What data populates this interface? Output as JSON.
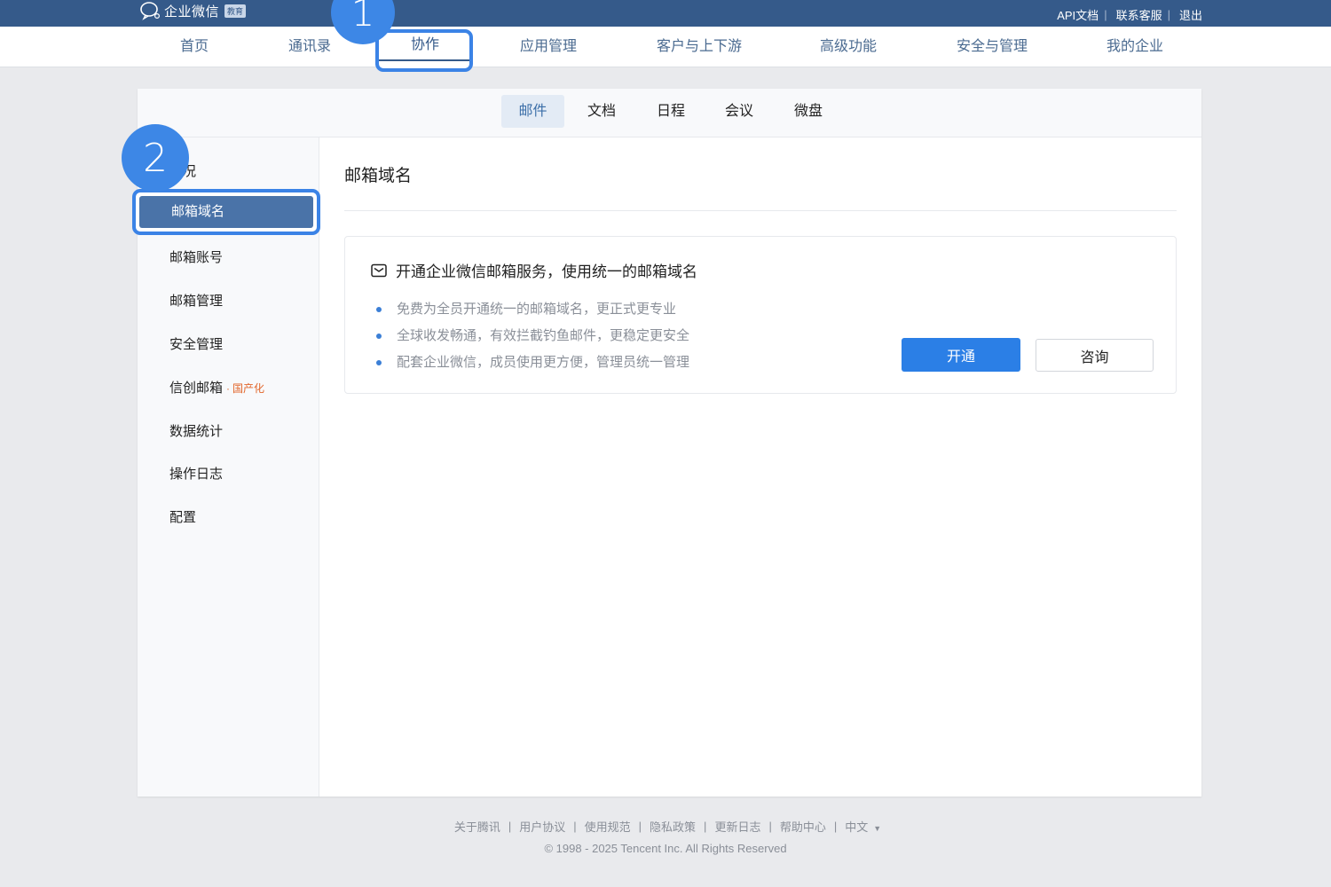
{
  "header": {
    "logo_text": "企业微信",
    "logo_badge": "教育",
    "links": [
      "API文档",
      "联系客服",
      "退出"
    ]
  },
  "nav": {
    "items": [
      "首页",
      "通讯录",
      "协作",
      "应用管理",
      "客户与上下游",
      "高级功能",
      "安全与管理",
      "我的企业"
    ],
    "active": "协作"
  },
  "steps": [
    "1",
    "2"
  ],
  "subtabs": {
    "items": [
      "邮件",
      "文档",
      "日程",
      "会议",
      "微盘"
    ],
    "active": "邮件"
  },
  "sidebar": {
    "items": [
      {
        "label": "概况"
      },
      {
        "label": "邮箱域名"
      },
      {
        "label": "邮箱账号"
      },
      {
        "label": "邮箱管理"
      },
      {
        "label": "安全管理"
      },
      {
        "label": "信创邮箱",
        "dot": "·",
        "tag": "国产化"
      },
      {
        "label": "数据统计"
      },
      {
        "label": "操作日志"
      },
      {
        "label": "配置"
      }
    ],
    "active": "邮箱域名"
  },
  "content": {
    "title": "邮箱域名",
    "promo": {
      "heading": "开通企业微信邮箱服务，使用统一的邮箱域名",
      "bullets": [
        "免费为全员开通统一的邮箱域名，更正式更专业",
        "全球收发畅通，有效拦截钓鱼邮件，更稳定更安全",
        "配套企业微信，成员使用更方便，管理员统一管理"
      ],
      "primary_button": "开通",
      "secondary_button": "咨询"
    }
  },
  "footer": {
    "links": [
      "关于腾讯",
      "用户协议",
      "使用规范",
      "隐私政策",
      "更新日志",
      "帮助中心",
      "中文"
    ],
    "copyright": "© 1998 - 2025 Tencent Inc. All Rights Reserved"
  },
  "colors": {
    "topbar": "#355a8a",
    "accent": "#2b7fe6",
    "highlight": "#3b83e6",
    "tag": "#e2672c"
  }
}
